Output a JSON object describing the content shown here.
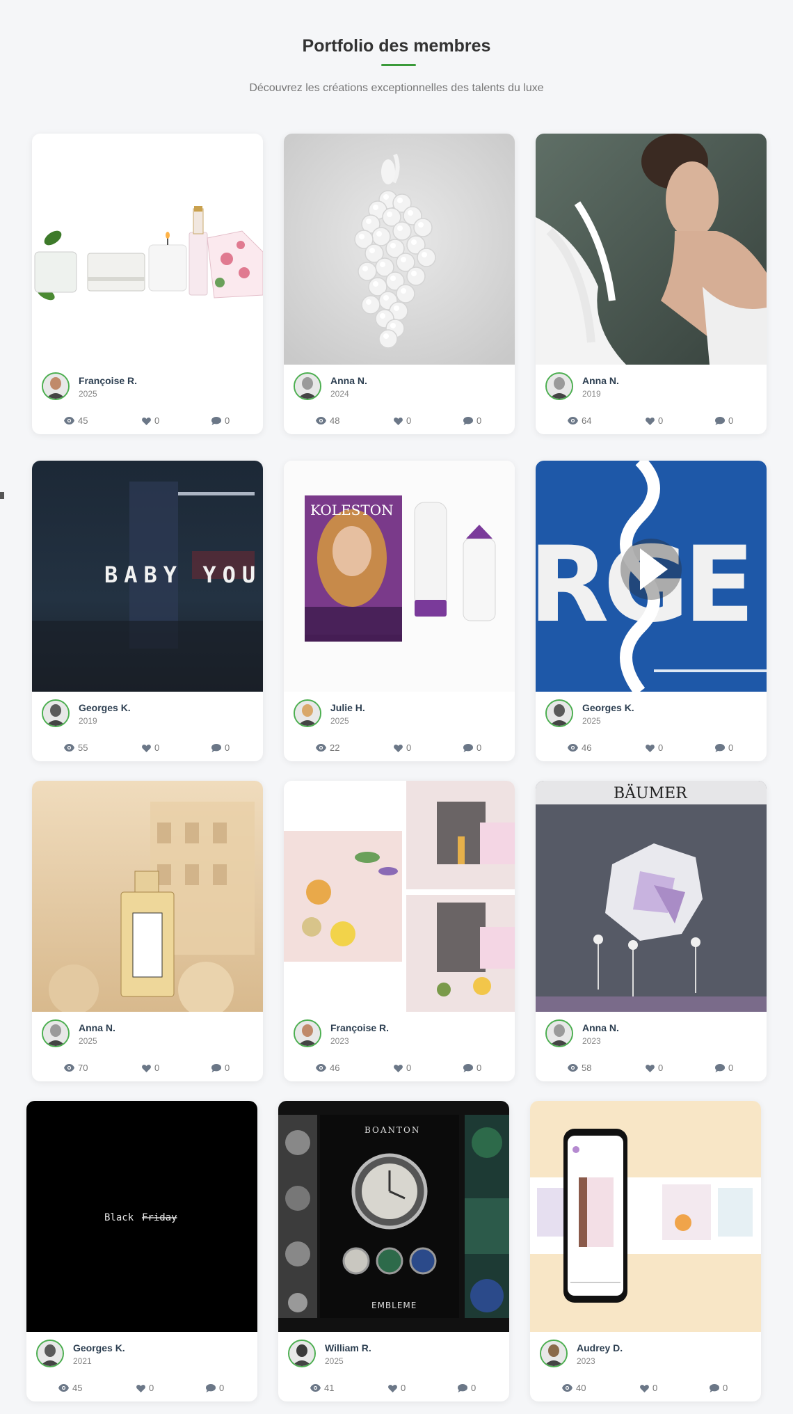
{
  "header": {
    "title": "Portfolio des membres",
    "subtitle": "Découvrez les créations exceptionnelles des talents du luxe"
  },
  "colors": {
    "accent": "#3a9a3a",
    "avatar_ring": "#4caf50"
  },
  "icons": {
    "views": "eye-icon",
    "likes": "heart-icon",
    "comments": "comment-icon"
  },
  "cards": [
    {
      "author": "Françoise R.",
      "year": "2025",
      "views": "45",
      "likes": "0",
      "comments": "0",
      "thumb": "cosmetics-products"
    },
    {
      "author": "Anna N.",
      "year": "2024",
      "views": "48",
      "likes": "0",
      "comments": "0",
      "thumb": "white-grape-sculpture"
    },
    {
      "author": "Anna N.",
      "year": "2019",
      "views": "64",
      "likes": "0",
      "comments": "0",
      "thumb": "feather-portrait"
    },
    {
      "author": "Georges K.",
      "year": "2019",
      "views": "55",
      "likes": "0",
      "comments": "0",
      "thumb": "video-still",
      "image_text": "BABY YOU"
    },
    {
      "author": "Julie H.",
      "year": "2025",
      "views": "22",
      "likes": "0",
      "comments": "0",
      "thumb": "hair-color-pack",
      "image_text": "KOLESTON"
    },
    {
      "author": "Georges K.",
      "year": "2025",
      "views": "46",
      "likes": "0",
      "comments": "0",
      "thumb": "video-typography",
      "image_text": "RGE KHA"
    },
    {
      "author": "Anna N.",
      "year": "2025",
      "views": "70",
      "likes": "0",
      "comments": "0",
      "thumb": "perfume-bottle"
    },
    {
      "author": "Françoise R.",
      "year": "2023",
      "views": "46",
      "likes": "0",
      "comments": "0",
      "thumb": "skincare-collage"
    },
    {
      "author": "Anna N.",
      "year": "2023",
      "views": "58",
      "likes": "0",
      "comments": "0",
      "thumb": "window-display",
      "image_text": "BÄUMER"
    },
    {
      "author": "Georges K.",
      "year": "2021",
      "views": "45",
      "likes": "0",
      "comments": "0",
      "thumb": "black-friday",
      "image_text": "Black",
      "image_text_struck": "Friday"
    },
    {
      "author": "William R.",
      "year": "2025",
      "views": "41",
      "likes": "0",
      "comments": "0",
      "thumb": "watch-poster",
      "image_text": "BOANTON",
      "image_subtext": "EMBLEME"
    },
    {
      "author": "Audrey D.",
      "year": "2023",
      "views": "40",
      "likes": "0",
      "comments": "0",
      "thumb": "phone-mockup"
    }
  ]
}
